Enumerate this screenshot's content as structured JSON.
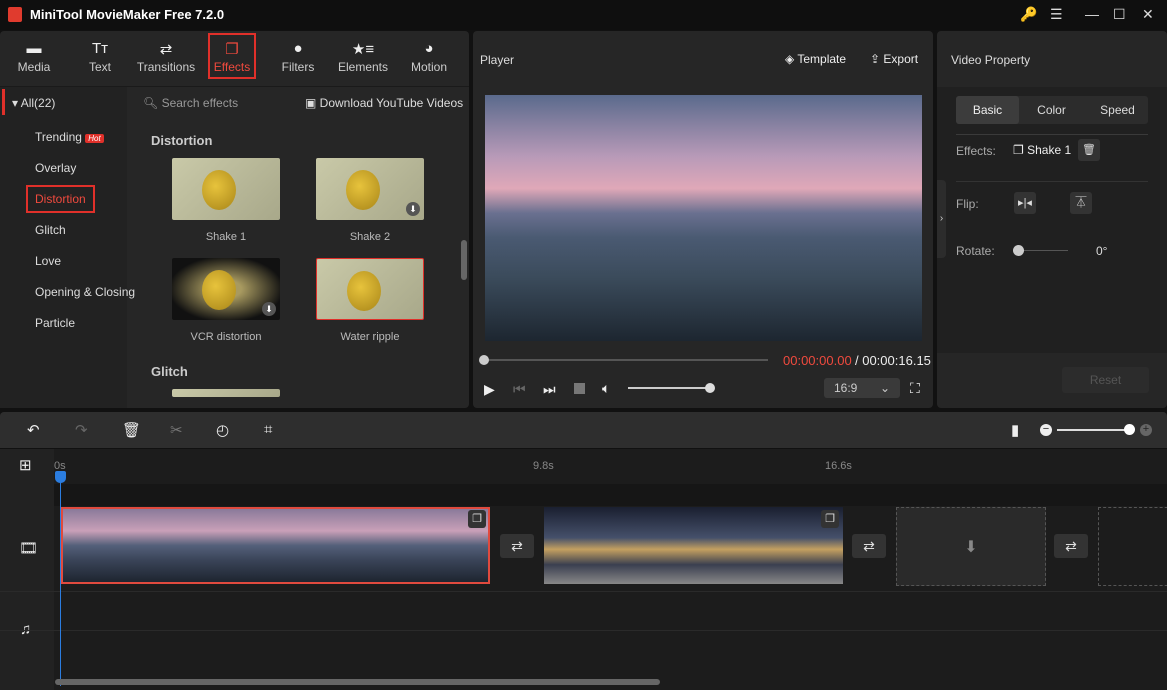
{
  "app": {
    "title": "MiniTool MovieMaker Free 7.2.0"
  },
  "toolbar": {
    "items": [
      {
        "label": "Media",
        "icon": "folder-icon"
      },
      {
        "label": "Text",
        "icon": "text-icon"
      },
      {
        "label": "Transitions",
        "icon": "transitions-icon"
      },
      {
        "label": "Effects",
        "icon": "effects-icon",
        "active": true
      },
      {
        "label": "Filters",
        "icon": "filters-icon"
      },
      {
        "label": "Elements",
        "icon": "elements-icon"
      },
      {
        "label": "Motion",
        "icon": "motion-icon"
      }
    ]
  },
  "sidebar": {
    "all": "All(22)",
    "items": [
      "Trending",
      "Overlay",
      "Distortion",
      "Glitch",
      "Love",
      "Opening & Closing",
      "Particle"
    ],
    "hot_badge": "Hot",
    "selected": "Distortion"
  },
  "effects": {
    "search_placeholder": "Search effects",
    "download_link": "Download YouTube Videos",
    "section1": "Distortion",
    "section2": "Glitch",
    "items": [
      "Shake 1",
      "Shake 2",
      "VCR distortion",
      "Water ripple"
    ]
  },
  "player": {
    "title": "Player",
    "template": "Template",
    "export": "Export",
    "current_time": "00:00:00.00",
    "total_time": "/ 00:00:16.15",
    "aspect": "16:9",
    "volume": 0.9,
    "progress": 0
  },
  "property": {
    "title": "Video Property",
    "tabs": [
      "Basic",
      "Color",
      "Speed"
    ],
    "active_tab": "Basic",
    "effects_label": "Effects:",
    "effect_name": "Shake 1",
    "flip_label": "Flip:",
    "rotate_label": "Rotate:",
    "rotate_value": "0°",
    "reset": "Reset"
  },
  "timeline": {
    "ticks": [
      "0s",
      "9.8s",
      "16.6s"
    ],
    "zoom": 1.0
  },
  "colors": {
    "accent": "#f04a3e",
    "playhead": "#2b7de0"
  }
}
